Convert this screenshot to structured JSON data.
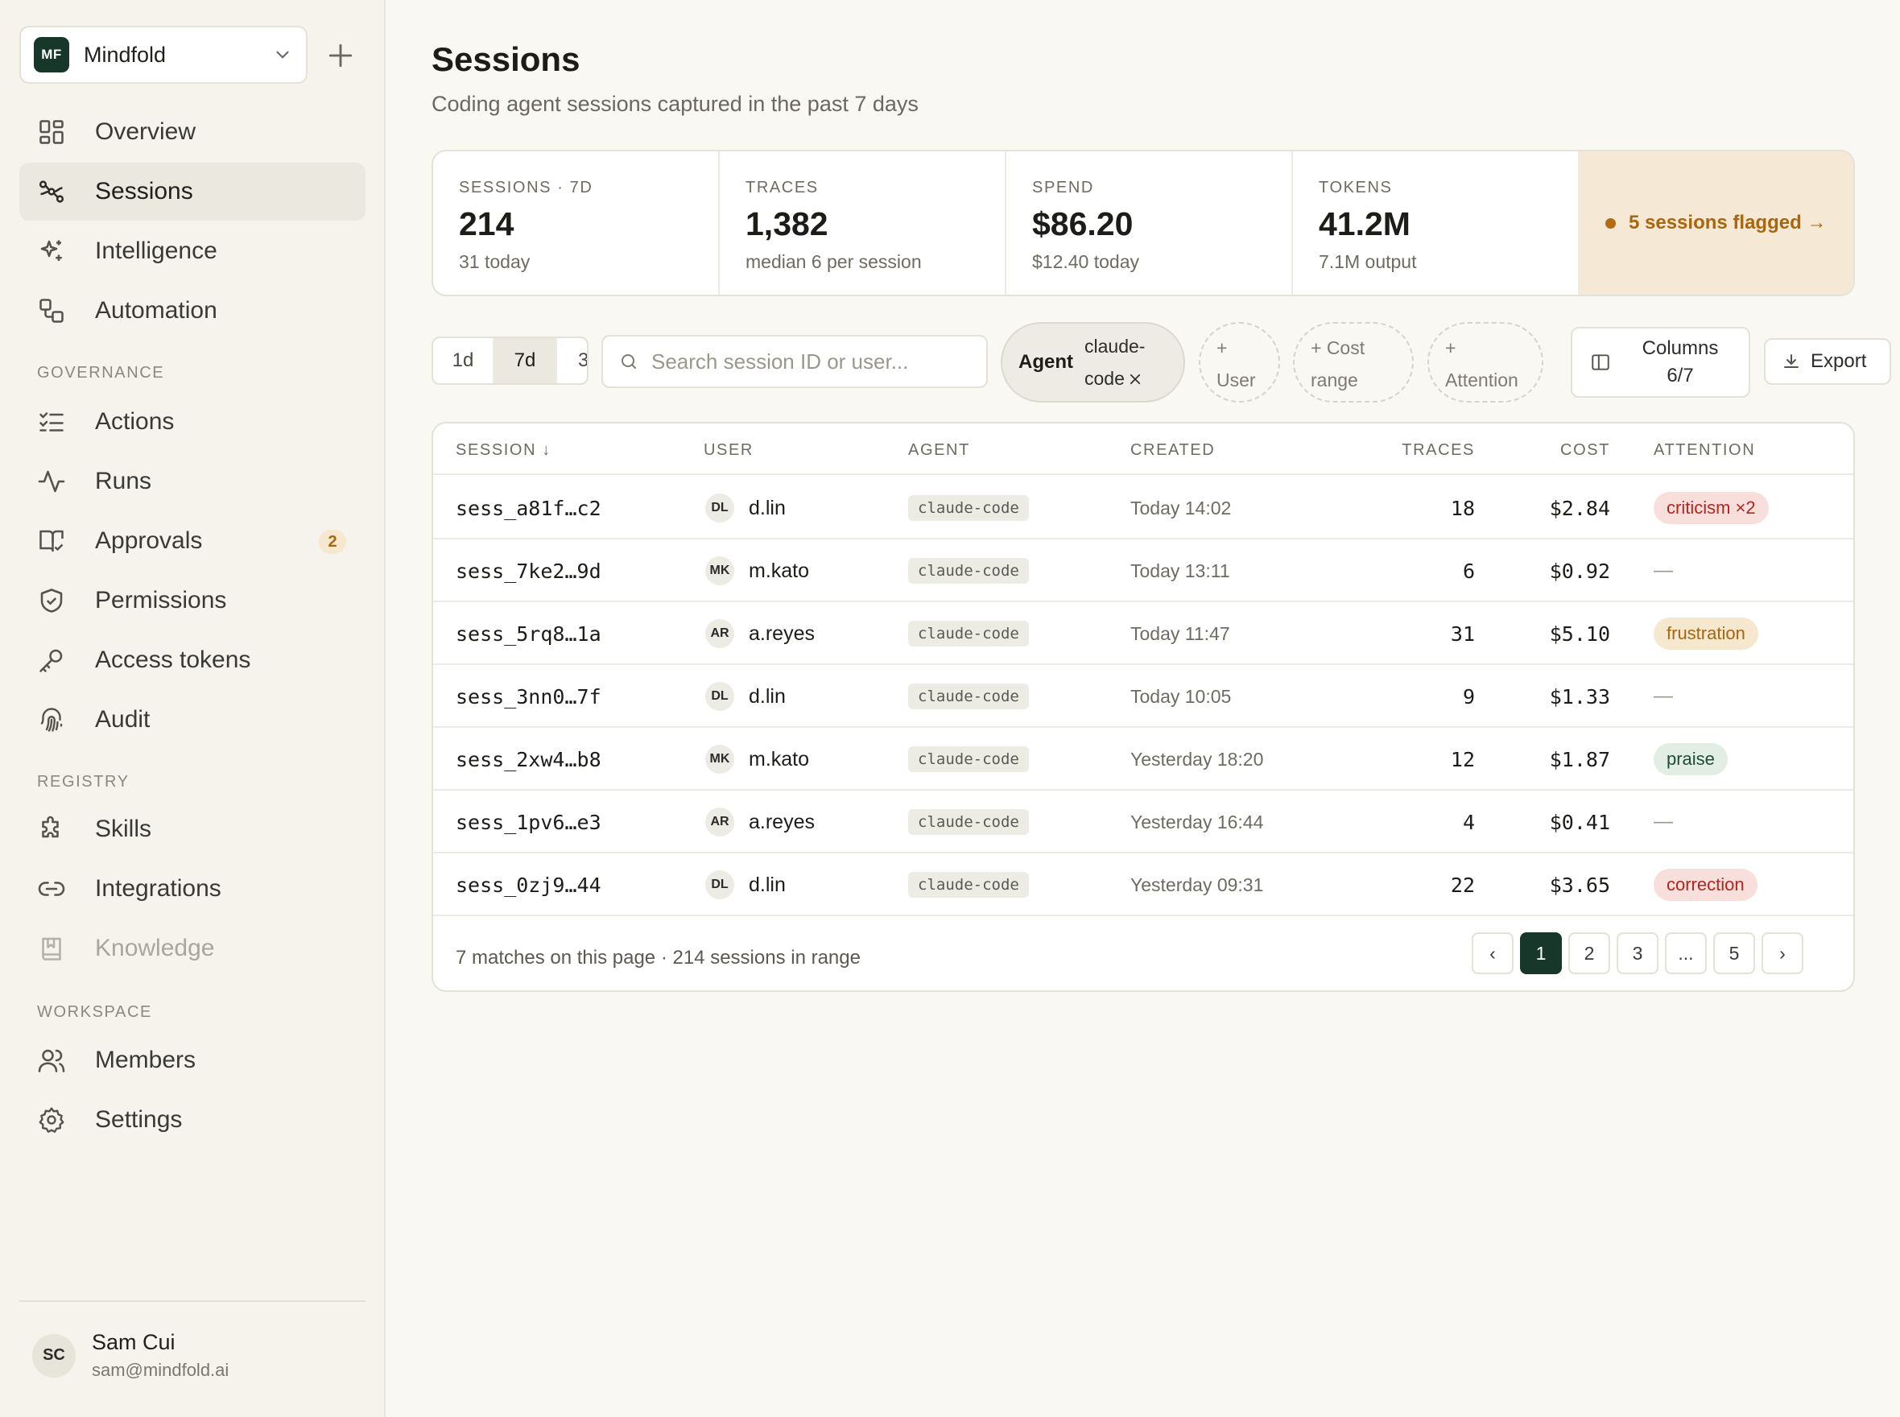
{
  "workspace": {
    "initials": "MF",
    "name": "Mindfold"
  },
  "nav": {
    "main": [
      {
        "label": "Overview",
        "icon": "grid-icon"
      },
      {
        "label": "Sessions",
        "icon": "sessions-icon",
        "active": true
      },
      {
        "label": "Intelligence",
        "icon": "sparkles-icon"
      },
      {
        "label": "Automation",
        "icon": "automation-icon"
      }
    ],
    "governance_label": "GOVERNANCE",
    "governance": [
      {
        "label": "Actions",
        "icon": "checklist-icon"
      },
      {
        "label": "Runs",
        "icon": "activity-icon"
      },
      {
        "label": "Approvals",
        "icon": "book-check-icon",
        "count": "2"
      },
      {
        "label": "Permissions",
        "icon": "shield-check-icon"
      },
      {
        "label": "Access tokens",
        "icon": "key-icon"
      },
      {
        "label": "Audit",
        "icon": "fingerprint-icon"
      }
    ],
    "registry_label": "REGISTRY",
    "registry": [
      {
        "label": "Skills",
        "icon": "puzzle-icon"
      },
      {
        "label": "Integrations",
        "icon": "link-icon"
      },
      {
        "label": "Knowledge",
        "icon": "bookmark-book-icon",
        "disabled": true
      }
    ],
    "workspace_label": "WORKSPACE",
    "workspace": [
      {
        "label": "Members",
        "icon": "users-icon"
      },
      {
        "label": "Settings",
        "icon": "gear-icon"
      }
    ]
  },
  "user": {
    "initials": "SC",
    "name": "Sam Cui",
    "email": "sam@mindfold.ai"
  },
  "header": {
    "title": "Sessions",
    "subtitle": "Coding agent sessions captured in the past 7 days"
  },
  "stats": [
    {
      "label": "SESSIONS · 7D",
      "value": "214",
      "sub": "31 today"
    },
    {
      "label": "TRACES",
      "value": "1,382",
      "sub": "median 6 per session"
    },
    {
      "label": "SPEND",
      "value": "$86.20",
      "sub": "$12.40 today"
    },
    {
      "label": "TOKENS",
      "value": "41.2M",
      "sub": "7.1M output"
    }
  ],
  "flagged": {
    "text": "5 sessions flagged →",
    "color": "#a8660e"
  },
  "toolbar": {
    "ranges": [
      "1d",
      "7d",
      "3"
    ],
    "active_range": "7d",
    "search_placeholder": "Search session ID or user...",
    "agent_filter": {
      "key": "Agent",
      "value_line1": "claude-",
      "value_line2": "code"
    },
    "add_filters": [
      {
        "line1": "+",
        "line2": "User"
      },
      {
        "line1": "+ Cost",
        "line2": "range"
      },
      {
        "line1": "+",
        "line2": "Attention"
      }
    ],
    "columns": {
      "line1": "Columns",
      "line2": "6/7"
    },
    "export": "Export"
  },
  "table": {
    "headers": {
      "session": "SESSION ↓",
      "user": "USER",
      "agent": "AGENT",
      "created": "CREATED",
      "traces": "TRACES",
      "cost": "COST",
      "attention": "ATTENTION"
    },
    "rows": [
      {
        "session": "sess_a81f…c2",
        "initials": "DL",
        "user": "d.lin",
        "agent": "claude-code",
        "created": "Today 14:02",
        "traces": "18",
        "cost": "$2.84",
        "attention": "criticism ×2",
        "att_type": "red"
      },
      {
        "session": "sess_7ke2…9d",
        "initials": "MK",
        "user": "m.kato",
        "agent": "claude-code",
        "created": "Today 13:11",
        "traces": "6",
        "cost": "$0.92",
        "attention": "—",
        "att_type": "none"
      },
      {
        "session": "sess_5rq8…1a",
        "initials": "AR",
        "user": "a.reyes",
        "agent": "claude-code",
        "created": "Today 11:47",
        "traces": "31",
        "cost": "$5.10",
        "attention": "frustration",
        "att_type": "amber"
      },
      {
        "session": "sess_3nn0…7f",
        "initials": "DL",
        "user": "d.lin",
        "agent": "claude-code",
        "created": "Today 10:05",
        "traces": "9",
        "cost": "$1.33",
        "attention": "—",
        "att_type": "none"
      },
      {
        "session": "sess_2xw4…b8",
        "initials": "MK",
        "user": "m.kato",
        "agent": "claude-code",
        "created": "Yesterday 18:20",
        "traces": "12",
        "cost": "$1.87",
        "attention": "praise",
        "att_type": "green"
      },
      {
        "session": "sess_1pv6…e3",
        "initials": "AR",
        "user": "a.reyes",
        "agent": "claude-code",
        "created": "Yesterday 16:44",
        "traces": "4",
        "cost": "$0.41",
        "attention": "—",
        "att_type": "none"
      },
      {
        "session": "sess_0zj9…44",
        "initials": "DL",
        "user": "d.lin",
        "agent": "claude-code",
        "created": "Yesterday 09:31",
        "traces": "22",
        "cost": "$3.65",
        "attention": "correction",
        "att_type": "red"
      }
    ],
    "footer": "7 matches on this page · 214 sessions in range",
    "pagination": [
      "‹",
      "1",
      "2",
      "3",
      "...",
      "5",
      "›"
    ],
    "current_page": "1"
  },
  "colors": {
    "brand": "#17372a",
    "att_red_bg": "#f8dfdc",
    "att_red_fg": "#b3261e",
    "att_amber_bg": "#f6e7cf",
    "att_amber_fg": "#a8660e",
    "att_green_bg": "#e2ede4",
    "att_green_fg": "#1f4d33"
  }
}
